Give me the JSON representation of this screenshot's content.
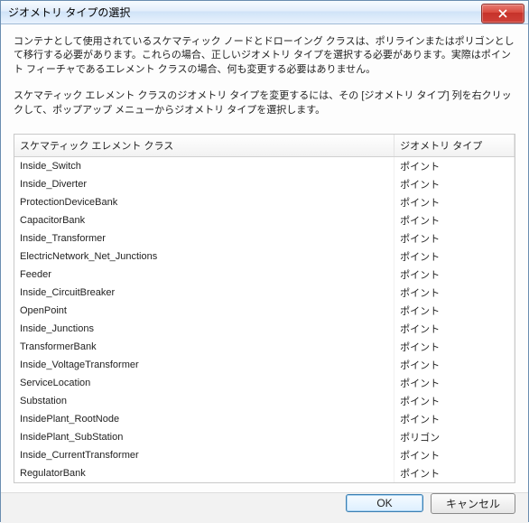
{
  "title": "ジオメトリ タイプの選択",
  "instructions": {
    "p1": "コンテナとして使用されているスケマティック ノードとドローイング クラスは、ポリラインまたはポリゴンとして移行する必要があります。これらの場合、正しいジオメトリ タイプを選択する必要があります。実際はポイント フィーチャであるエレメント クラスの場合、何も変更する必要はありません。",
    "p2": "スケマティック エレメント クラスのジオメトリ タイプを変更するには、その [ジオメトリ タイプ] 列を右クリックして、ポップアップ メニューからジオメトリ タイプを選択します。"
  },
  "columns": {
    "class": "スケマティック エレメント クラス",
    "geom": "ジオメトリ タイプ"
  },
  "rows": [
    {
      "class": "Inside_Switch",
      "geom": "ポイント"
    },
    {
      "class": "Inside_Diverter",
      "geom": "ポイント"
    },
    {
      "class": "ProtectionDeviceBank",
      "geom": "ポイント"
    },
    {
      "class": "CapacitorBank",
      "geom": "ポイント"
    },
    {
      "class": "Inside_Transformer",
      "geom": "ポイント"
    },
    {
      "class": "ElectricNetwork_Net_Junctions",
      "geom": "ポイント"
    },
    {
      "class": "Feeder",
      "geom": "ポイント"
    },
    {
      "class": "Inside_CircuitBreaker",
      "geom": "ポイント"
    },
    {
      "class": "OpenPoint",
      "geom": "ポイント"
    },
    {
      "class": "Inside_Junctions",
      "geom": "ポイント"
    },
    {
      "class": "TransformerBank",
      "geom": "ポイント"
    },
    {
      "class": "Inside_VoltageTransformer",
      "geom": "ポイント"
    },
    {
      "class": "ServiceLocation",
      "geom": "ポイント"
    },
    {
      "class": "Substation",
      "geom": "ポイント"
    },
    {
      "class": "InsidePlant_RootNode",
      "geom": "ポイント"
    },
    {
      "class": "InsidePlant_SubStation",
      "geom": "ポリゴン"
    },
    {
      "class": "Inside_CurrentTransformer",
      "geom": "ポイント"
    },
    {
      "class": "RegulatorBank",
      "geom": "ポイント"
    }
  ],
  "buttons": {
    "ok": "OK",
    "cancel": "キャンセル"
  }
}
